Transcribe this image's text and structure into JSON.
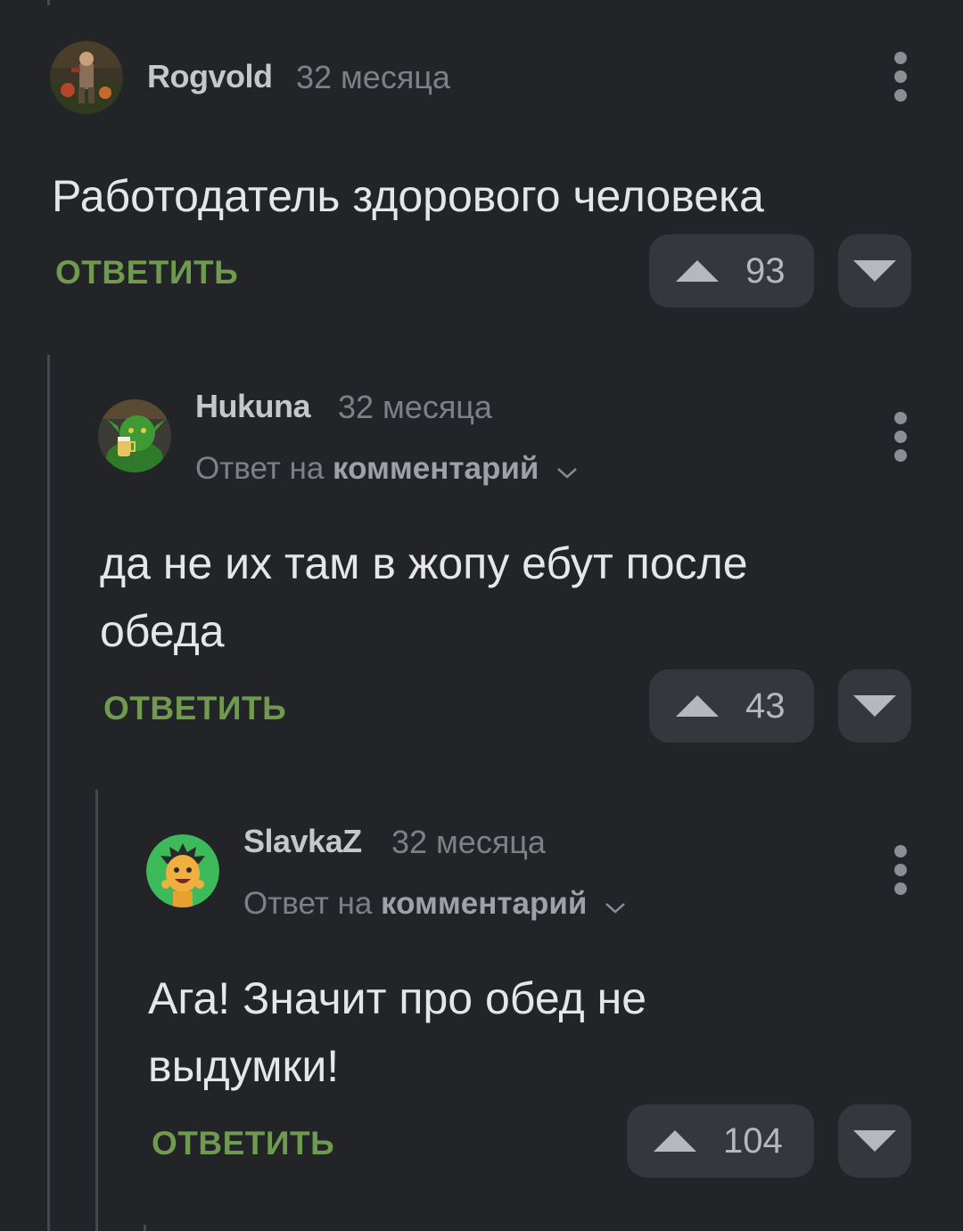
{
  "comments": [
    {
      "username": "Rogvold",
      "time": "32 месяца",
      "text": "Работодатель здорового человека",
      "reply_label": "ОТВЕТИТЬ",
      "votes": "93"
    },
    {
      "username": "Hukuna",
      "time": "32 месяца",
      "reply_prefix": "Ответ на",
      "reply_target": "комментарий",
      "text_line1": "да не их там в жопу ебут после",
      "text_line2": "обеда",
      "reply_label": "ОТВЕТИТЬ",
      "votes": "43"
    },
    {
      "username": "SlavkaZ",
      "time": "32 месяца",
      "reply_prefix": "Ответ на",
      "reply_target": "комментарий",
      "text_line1": "Ага! Значит про обед не",
      "text_line2": "выдумки!",
      "reply_label": "ОТВЕТИТЬ",
      "votes": "104"
    }
  ],
  "icons": {
    "menu": "more-vertical-icon",
    "upvote": "triangle-up-icon",
    "downvote": "triangle-down-icon",
    "expand": "chevron-down-icon"
  },
  "colors": {
    "background": "#222428",
    "reply_accent": "#6f9a4f",
    "vote_bg": "#35373c",
    "thread_line": "#45484e"
  }
}
